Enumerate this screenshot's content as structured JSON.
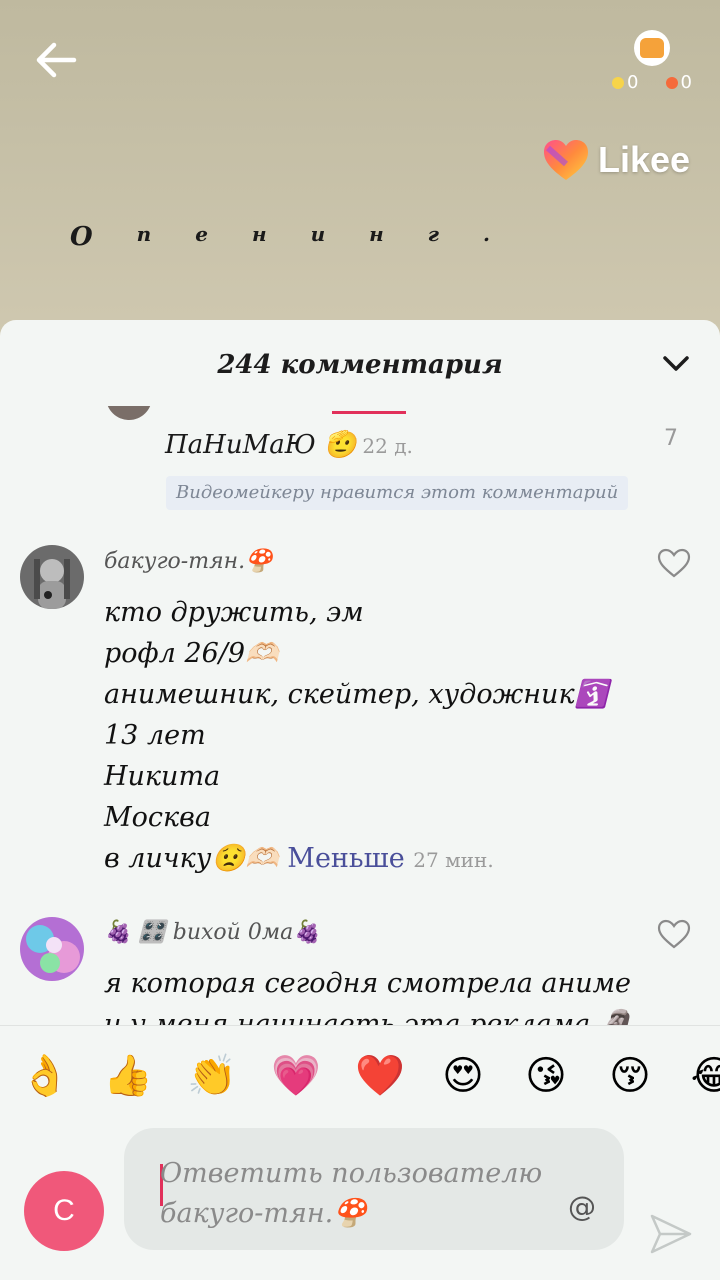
{
  "video": {
    "caption_letters": [
      "О",
      "п",
      "е",
      "н",
      "и",
      "н",
      "г",
      "."
    ],
    "stats": {
      "gems": "0",
      "fire": "0"
    },
    "brand": "Likee"
  },
  "comments_sheet": {
    "title": "244 комментария",
    "reply": {
      "text": "ПаНиМаЮ 🫡",
      "time": "22 д.",
      "likes": "7",
      "creator_liked": "Видеомейкеру нравится этот комментарий"
    },
    "comments": [
      {
        "author": "бакуго-тян.🍄",
        "lines": [
          "кто дружить, эм",
          "рофл 26/9🫶🏻",
          "анимешник, скейтер, художник🛐",
          "13 лет",
          "Никита",
          "Москва"
        ],
        "last_line": "в личку😟🫶🏻",
        "less_link": "Меньше",
        "time": "27 мин."
      },
      {
        "author": "🍇 🎛️ bихой 0ма🍇",
        "lines": [
          "я которая сегодня смотрела аниме",
          "и у меня начинаеть эта реклама 🗿"
        ]
      }
    ]
  },
  "reaction_emojis": [
    "👌",
    "👍",
    "👏",
    "💗",
    "❤️",
    "😍",
    "😘",
    "😚",
    "😂"
  ],
  "reply_input": {
    "placeholder_line1": "Ответить пользователю",
    "placeholder_line2": "бакуго-тян.🍄",
    "at_symbol": "@",
    "me_initial": "C"
  },
  "colors": {
    "accent_pink": "#e1305a",
    "avatar_pink": "#f0587a",
    "less_link": "#4a4f9a"
  }
}
